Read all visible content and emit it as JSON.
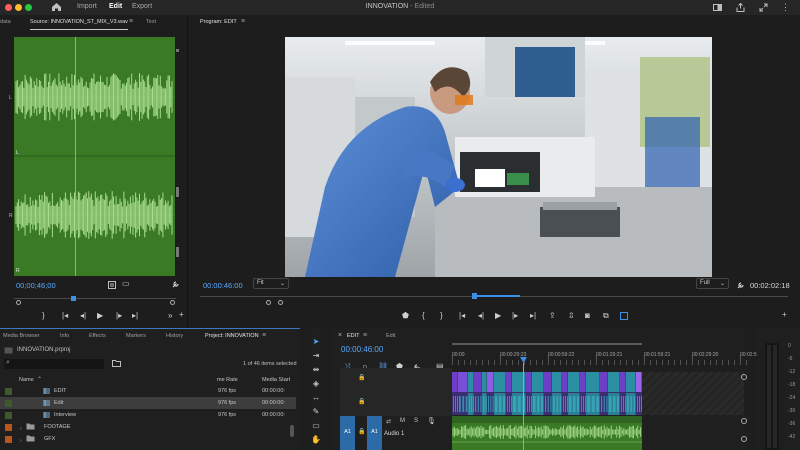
{
  "app": {
    "title": "INNOVATION",
    "title_suffix": " - Edited",
    "menu": [
      "Import",
      "Edit",
      "Export"
    ],
    "active_menu": "Edit"
  },
  "source": {
    "tabs": [
      "data",
      "Source: INNOVATION_ST_MIX_V3.wav",
      "Text"
    ],
    "timecode": "00;00;46;00",
    "channel_labels": [
      "L",
      "R",
      "L",
      "R"
    ]
  },
  "program": {
    "tab": "Program: EDIT",
    "timecode": "00:00:46:00",
    "fit": "Fit",
    "quality": "Full",
    "duration": "00:02:02:18"
  },
  "project": {
    "tabs": [
      "Media Browser",
      "Info",
      "Effects",
      "Markers",
      "History",
      "Project: INNOVATION"
    ],
    "file": "INNOVATION.prproj",
    "items_selected": "1 of 46 items selected",
    "columns": [
      "Name",
      "me Rate",
      "Media Start"
    ],
    "rows": [
      {
        "name": "EDIT",
        "rate": "976 fps",
        "start": "00:00:00:",
        "color": "#3c5a2a",
        "kind": "seq",
        "selected": false
      },
      {
        "name": "Edit",
        "rate": "976 fps",
        "start": "00:00:00:",
        "color": "#3c5a2a",
        "kind": "seq",
        "selected": true
      },
      {
        "name": "Interview",
        "rate": "976 fps",
        "start": "00:00:00:",
        "color": "#3c5a2a",
        "kind": "seq",
        "selected": false
      },
      {
        "name": "FOOTAGE",
        "rate": "",
        "start": "",
        "color": "#b8561f",
        "kind": "folder",
        "selected": false
      },
      {
        "name": "GFX",
        "rate": "",
        "start": "",
        "color": "#b8561f",
        "kind": "folder",
        "selected": false
      }
    ]
  },
  "timeline": {
    "tabs": [
      "EDIT",
      "Edit"
    ],
    "timecode": "00:00:46:00",
    "ruler": [
      "00:00",
      "00:00:29:23",
      "00:00:59:22",
      "00:01:29:21",
      "00:01:59:21",
      "00:02:29:20",
      "00:02:59:1"
    ],
    "track_labels": [
      "A1",
      "A1"
    ],
    "audio_track_name": "Audio 1",
    "track_buttons": [
      "M",
      "S"
    ]
  },
  "meters": {
    "scale": [
      "0",
      "-6",
      "-12",
      "-18",
      "-24",
      "-30",
      "-36",
      "-42"
    ]
  },
  "colors": {
    "accent": "#5aa9ff",
    "audio_wave_bg": "#3b7a25",
    "audio_wave": "#a6dc8c",
    "clip_purple": "#6d3fc7",
    "clip_teal": "#2b8fa4"
  }
}
